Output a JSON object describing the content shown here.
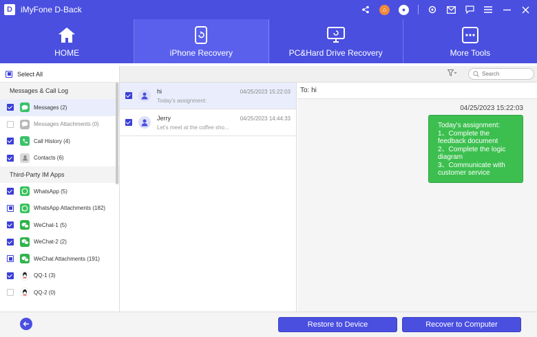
{
  "app": {
    "title": "iMyFone D-Back",
    "logo_letter": "D"
  },
  "titlebar_icons": [
    "share-icon",
    "cart-icon",
    "account-icon",
    "settings-icon",
    "mail-icon",
    "feedback-icon",
    "menu-icon",
    "minimize-icon",
    "close-icon"
  ],
  "nav": {
    "tabs": [
      {
        "label": "HOME",
        "icon": "home-icon"
      },
      {
        "label": "iPhone Recovery",
        "icon": "iphone-recovery-icon",
        "active": true
      },
      {
        "label": "PC&Hard Drive Recovery",
        "icon": "pc-recovery-icon"
      },
      {
        "label": "More Tools",
        "icon": "more-tools-icon"
      }
    ]
  },
  "sidebar": {
    "select_all": "Select All",
    "sections": [
      {
        "title": "Messages & Call Log",
        "items": [
          {
            "label": "Messages (2)",
            "state": "checked",
            "icon": "messages-icon",
            "active": true
          },
          {
            "label": "Messages Attachments (0)",
            "state": "unchecked",
            "icon": "messages-attachments-icon"
          },
          {
            "label": "Call History (4)",
            "state": "checked",
            "icon": "call-history-icon"
          },
          {
            "label": "Contacts (6)",
            "state": "checked",
            "icon": "contacts-icon"
          }
        ]
      },
      {
        "title": "Third-Party IM Apps",
        "items": [
          {
            "label": "WhatsApp (5)",
            "state": "checked",
            "icon": "whatsapp-icon"
          },
          {
            "label": "WhatsApp Attachments (182)",
            "state": "partial",
            "icon": "whatsapp-attachments-icon"
          },
          {
            "label": "WeChat-1 (5)",
            "state": "checked",
            "icon": "wechat-icon"
          },
          {
            "label": "WeChat-2 (2)",
            "state": "checked",
            "icon": "wechat-icon"
          },
          {
            "label": "WeChat Attachments (191)",
            "state": "partial",
            "icon": "wechat-attachments-icon"
          },
          {
            "label": "QQ-1 (3)",
            "state": "checked",
            "icon": "qq-icon"
          },
          {
            "label": "QQ-2 (0)",
            "state": "unchecked",
            "icon": "qq-icon"
          }
        ]
      }
    ]
  },
  "search": {
    "placeholder": "Search"
  },
  "messages": [
    {
      "name": "hi",
      "preview": "Today's assignment:",
      "time": "04/25/2023 15:22:03",
      "selected": true
    },
    {
      "name": "Jerry",
      "preview": "Let's meet at the coffee sho...",
      "time": "04/25/2023 14:44:33",
      "selected": false
    }
  ],
  "conversation": {
    "to_label": "To:  hi",
    "timestamp": "04/25/2023 15:22:03",
    "bubble_text": "Today's assignment:\n1、Complete the feedback document\n2、Complete the logic diagram\n3、Communicate with customer service"
  },
  "actions": {
    "restore_label": "Restore to Device",
    "recover_label": "Recover to Computer"
  },
  "colors": {
    "accent": "#4a4fe0",
    "bubble": "#3cbf4f"
  }
}
